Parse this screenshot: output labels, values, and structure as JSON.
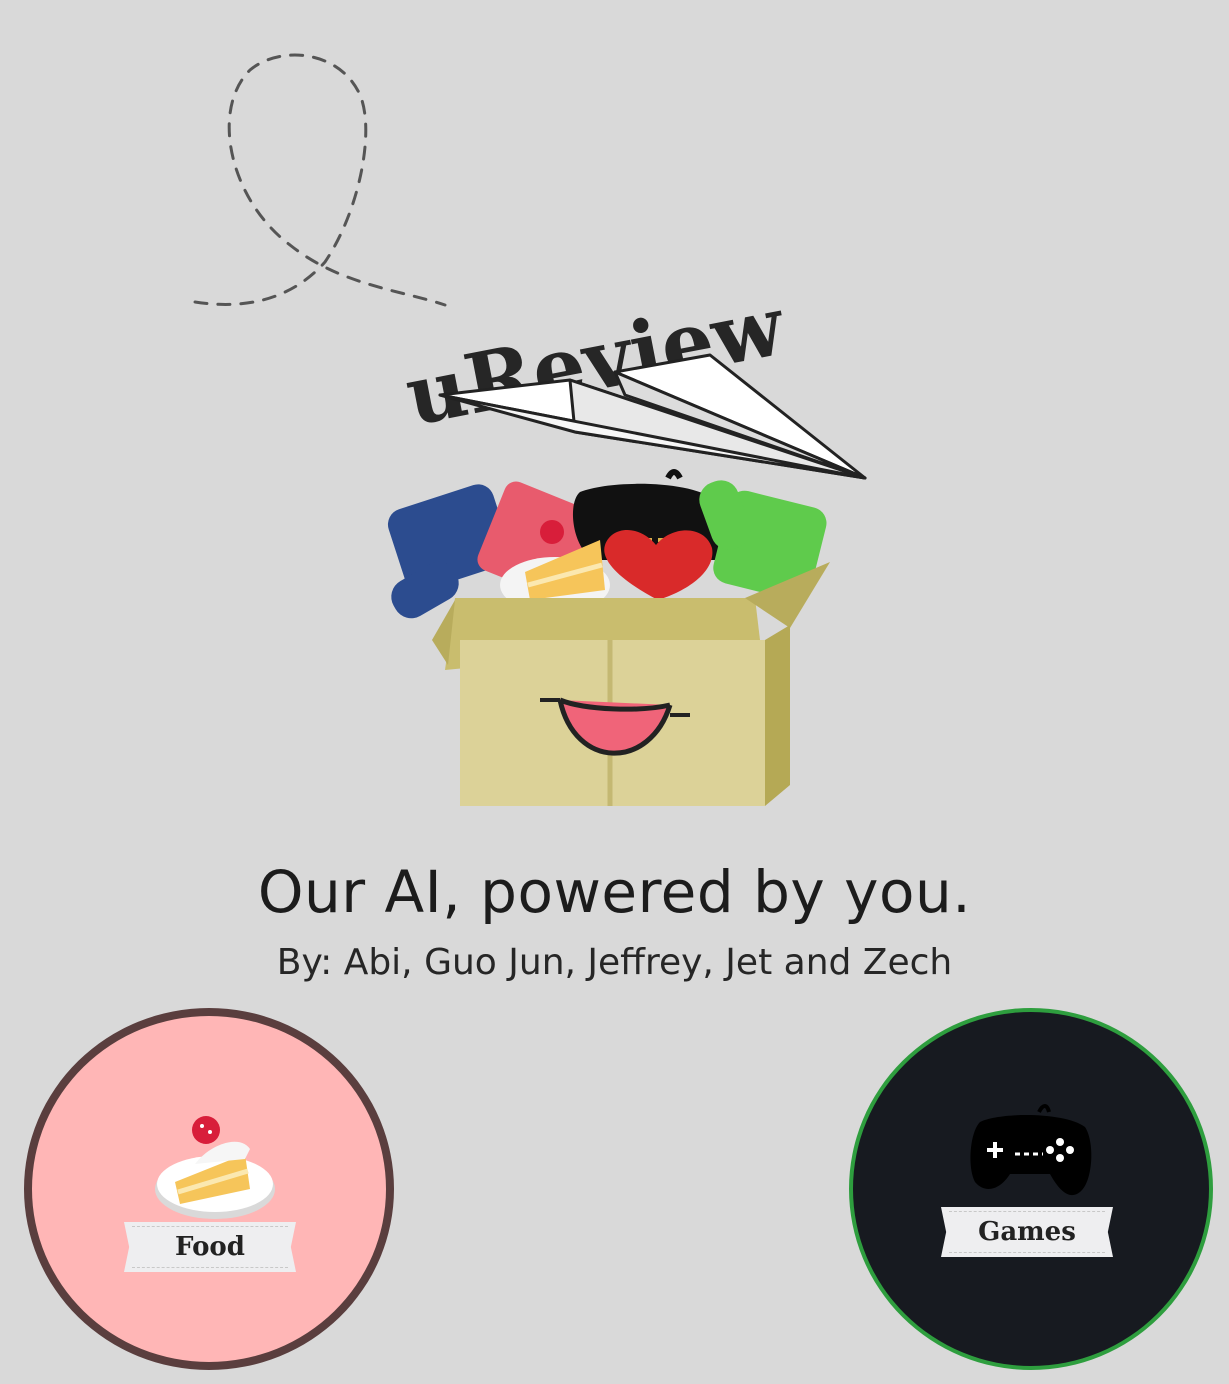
{
  "logo": {
    "wordmark": "uReview"
  },
  "hero": {
    "tagline": "Our AI, powered by you.",
    "byline": "By: Abi, Guo Jun, Jeffrey, Jet and Zech"
  },
  "categories": [
    {
      "label": "Food",
      "icon": "cake-icon",
      "color": "#ffb6b6",
      "border": "#5a3e3e"
    },
    {
      "label": "Games",
      "icon": "gamepad-icon",
      "color": "#171a20",
      "border": "#2e9e3e"
    }
  ]
}
